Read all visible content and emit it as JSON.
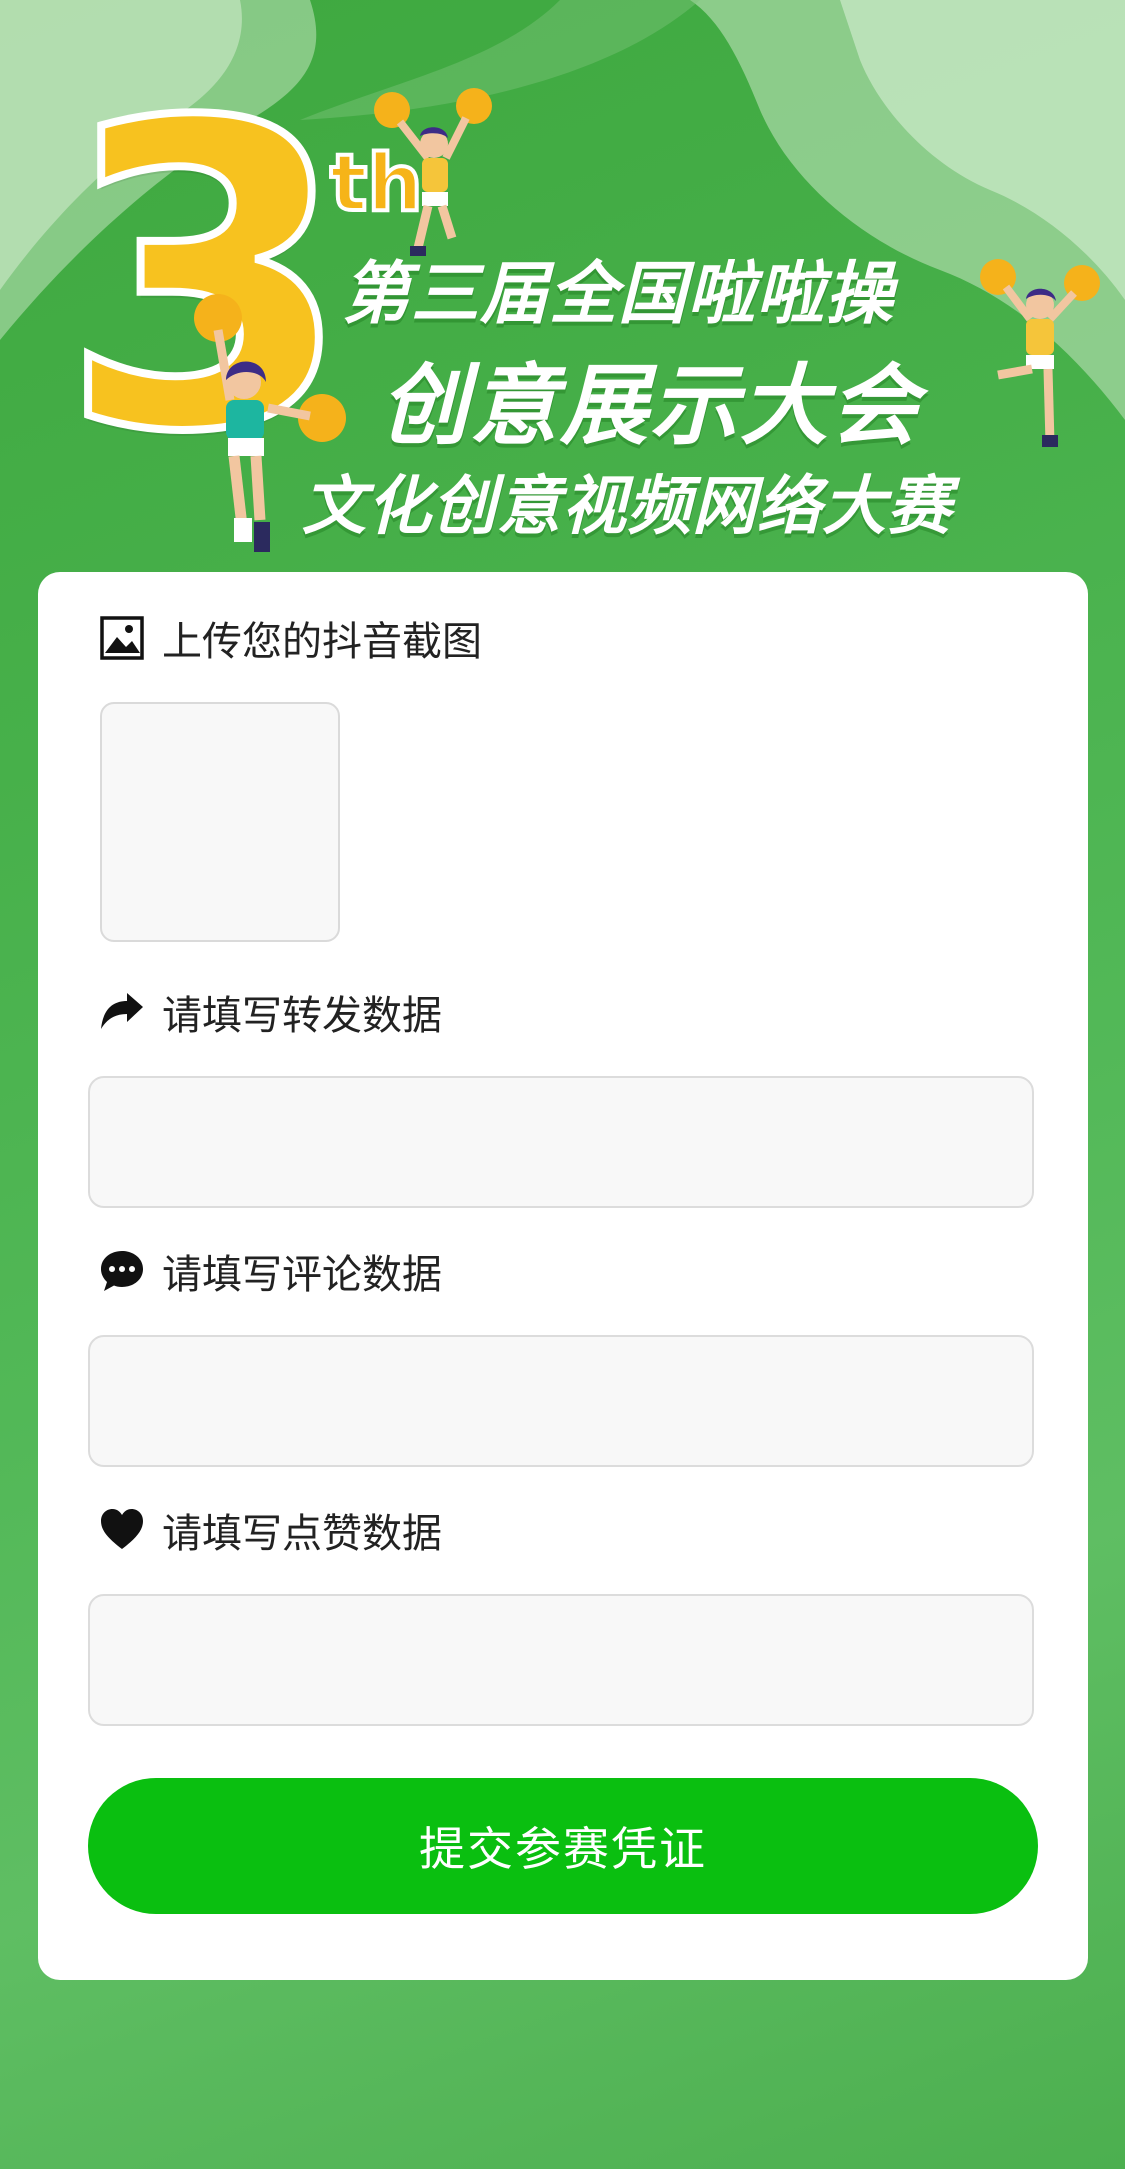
{
  "banner": {
    "big_number": "3",
    "ordinal": "th",
    "title_line1": "第三届全国啦啦操",
    "title_line2": "创意展示大会",
    "title_line3": "文化创意视频网络大赛"
  },
  "form": {
    "upload_label": "上传您的抖音截图",
    "share_label": "请填写转发数据",
    "share_value": "",
    "comment_label": "请填写评论数据",
    "comment_value": "",
    "like_label": "请填写点赞数据",
    "like_value": "",
    "submit_label": "提交参赛凭证"
  },
  "icons": {
    "upload": "image-icon",
    "share": "share-arrow-icon",
    "comment": "chat-bubble-icon",
    "like": "heart-icon"
  },
  "colors": {
    "background_green": "#47b04a",
    "button_green": "#0abf10",
    "accent_yellow": "#f7c21f"
  }
}
